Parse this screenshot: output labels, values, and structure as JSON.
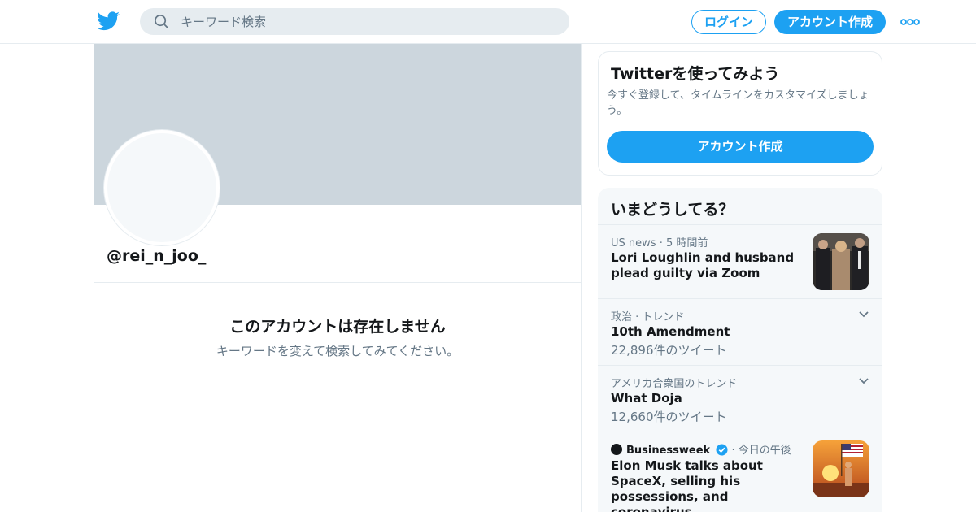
{
  "header": {
    "search_placeholder": "キーワード検索",
    "login_label": "ログイン",
    "signup_label": "アカウント作成",
    "brand_color": "#1da1f2"
  },
  "profile": {
    "handle": "@rei_n_joo_",
    "empty_title": "このアカウントは存在しません",
    "empty_subtitle": "キーワードを変えて検索してみてください。"
  },
  "signup_card": {
    "title": "Twitterを使ってみよう",
    "description": "今すぐ登録して、タイムラインをカスタマイズしましょう。",
    "button_label": "アカウント作成"
  },
  "trends": {
    "title": "いまどうしてる？",
    "items": [
      {
        "source": "US news",
        "time": "5 時間前",
        "title": "Lori Loughlin and husband plead guilty via Zoom",
        "thumbnail": "courtroom-photo"
      },
      {
        "context": "政治 · トレンド",
        "title": "10th Amendment",
        "count": "22,896件のツイート"
      },
      {
        "context": "アメリカ合衆国のトレンド",
        "title": "What Doja",
        "count": "12,660件のツイート"
      },
      {
        "source": "Businessweek",
        "verified": true,
        "time": "今日の午後",
        "title": "Elon Musk talks about SpaceX, selling his possessions, and coronavirus",
        "thumbnail": "flag-photo"
      }
    ]
  },
  "icons": [
    "twitter-bird-icon",
    "search-icon",
    "more-icon",
    "chevron-down-icon",
    "verified-icon"
  ]
}
